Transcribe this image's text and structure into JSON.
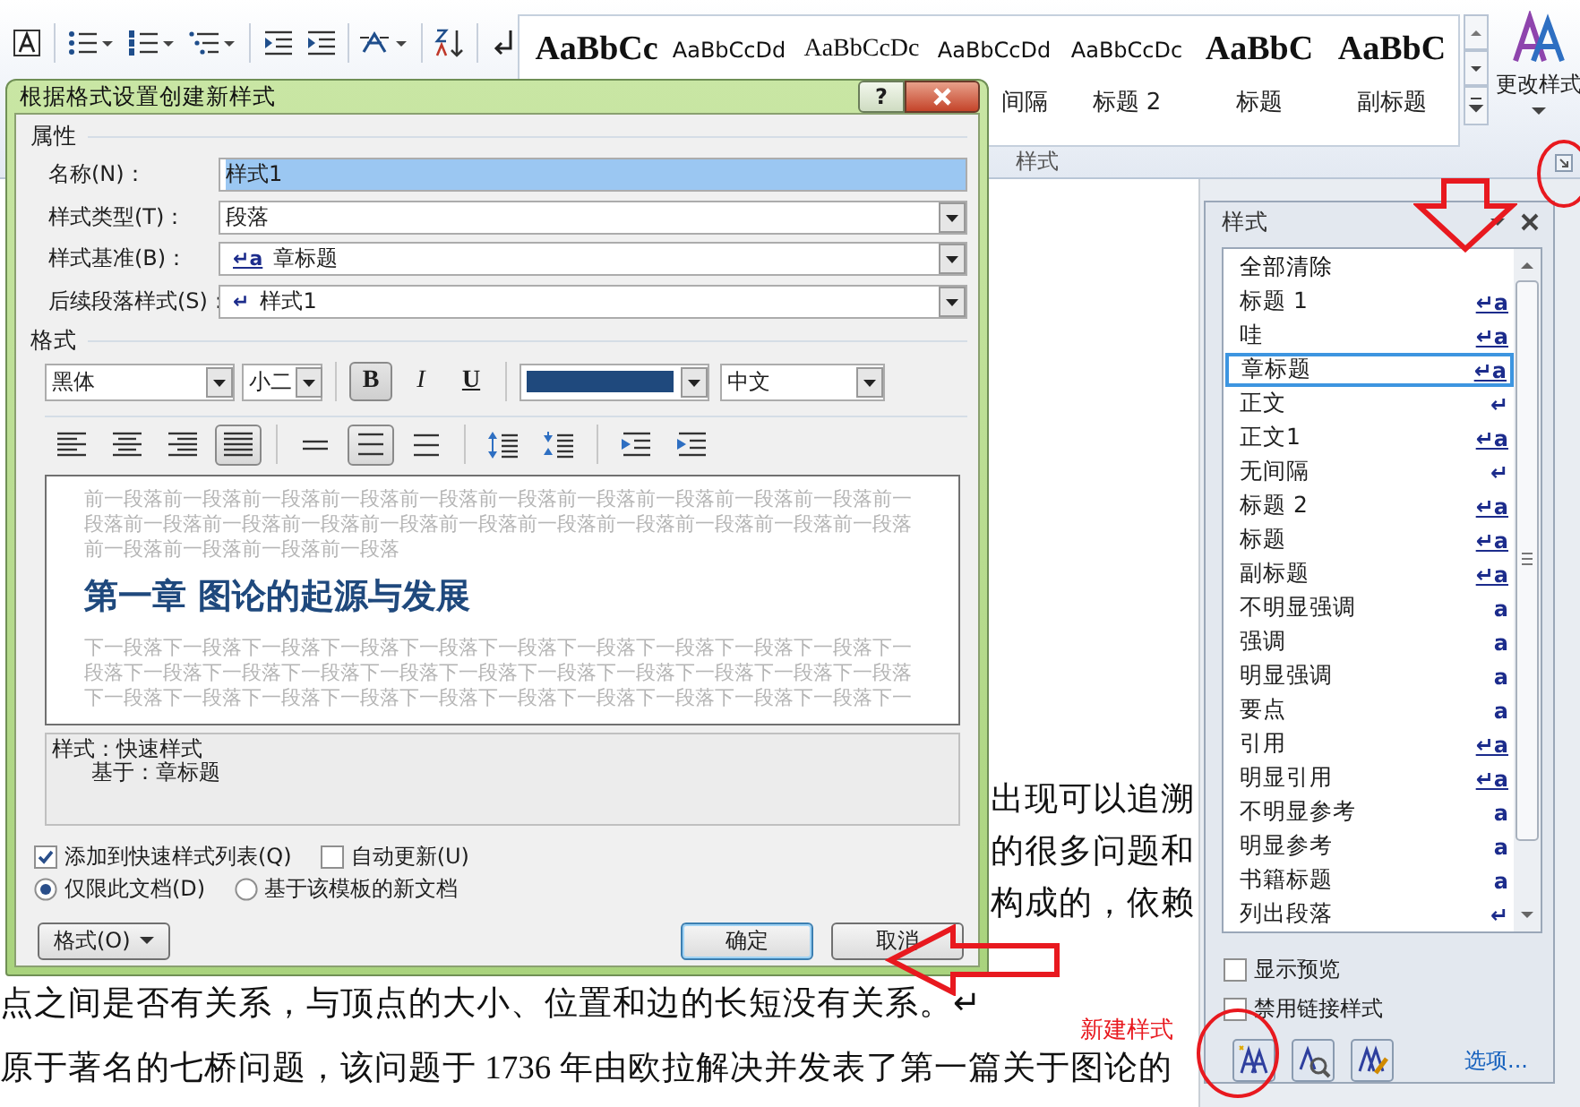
{
  "ribbon": {
    "gallery": [
      {
        "sample": "AaBbCc",
        "kind": "heading"
      },
      {
        "sample": "AaBbCcDd",
        "kind": "plain"
      },
      {
        "sample": "AaBbCcDc",
        "kind": "serif"
      },
      {
        "sample": "AaBbCcDd",
        "kind": "plain",
        "label": "间隔"
      },
      {
        "sample": "AaBbCcDc",
        "kind": "plain",
        "label": "标题 2"
      },
      {
        "sample": "AaBbC",
        "kind": "heading",
        "label": "标题"
      },
      {
        "sample": "AaBbC",
        "kind": "heading",
        "label": "副标题"
      }
    ],
    "change_styles": "更改样式",
    "group_label": "样式"
  },
  "document": {
    "lines": [
      {
        "text": "出现可以追溯",
        "kind": "tail"
      },
      {
        "text": "的很多问题和",
        "kind": "tail"
      },
      {
        "text": "构成的，依赖",
        "kind": "tail"
      },
      {
        "text": "点之间是否有关系，与顶点的大小、位置和边的长短没有关系。↵",
        "kind": "full"
      },
      {
        "text": "原于著名的七桥问题，该问题于 1736 年由欧拉解决并发表了第一篇关于图论的",
        "kind": "full"
      }
    ]
  },
  "dialog": {
    "title": "根据格式设置创建新样式",
    "help": "?",
    "properties": {
      "heading": "属性",
      "fields": [
        {
          "label": "名称(N)：",
          "value": "样式1",
          "kind": "text",
          "highlighted": true
        },
        {
          "label": "样式类型(T)：",
          "value": "段落",
          "kind": "select"
        },
        {
          "label": "样式基准(B)：",
          "marker": "↵a",
          "value": "章标题",
          "kind": "select"
        },
        {
          "label": "后续段落样式(S)：",
          "marker": "↵",
          "value": "样式1",
          "kind": "select"
        }
      ]
    },
    "format": {
      "heading": "格式",
      "font": "黑体",
      "size": "小二",
      "text_style_buttons": [
        {
          "label": "B",
          "pressed": true
        },
        {
          "label": "I",
          "pressed": false
        },
        {
          "label": "U",
          "pressed": false
        }
      ],
      "color": "#1f497d",
      "language": "中文",
      "paragraph_buttons": [
        {
          "selected": false
        },
        {
          "selected": false
        },
        {
          "selected": false
        },
        {
          "selected": true
        },
        {
          "selected": false
        },
        {
          "selected": true
        },
        {
          "selected": false
        },
        {
          "selected": false
        },
        {
          "selected": false
        },
        {
          "selected": false
        },
        {
          "selected": false
        }
      ]
    },
    "preview": {
      "before": "前一段落前一段落前一段落前一段落前一段落前一段落前一段落前一段落前一段落前一段落前一段落前一段落前一段落前一段落前一段落前一段落前一段落前一段落前一段落前一段落前一段落前一段落前一段落前一段落前一段落",
      "heading": "第一章  图论的起源与发展",
      "after": "下一段落下一段落下一段落下一段落下一段落下一段落下一段落下一段落下一段落下一段落下一段落下一段落下一段落下一段落下一段落下一段落下一段落下一段落下一段落下一段落下一段落下一段落下一段落下一段落下一段落下一段落下一段落下一段落下一段落下一段落下一段落下一"
    },
    "description": [
      "样式：快速样式",
      "基于：章标题"
    ],
    "options": [
      {
        "label": "添加到快速样式列表(Q)",
        "checked": true
      },
      {
        "label": "自动更新(U)",
        "checked": false
      }
    ],
    "scope": [
      {
        "label": "仅限此文档(D)",
        "selected": true
      },
      {
        "label": "基于该模板的新文档",
        "selected": false
      }
    ],
    "format_button": "格式(O)",
    "ok": "确定",
    "cancel": "取消"
  },
  "styles_pane": {
    "title": "样式",
    "items": [
      {
        "name": "全部清除",
        "kind": "clear",
        "selected": false
      },
      {
        "name": "标题 1",
        "kind": "linked",
        "marker": "↵a",
        "selected": false
      },
      {
        "name": "哇",
        "kind": "linked",
        "marker": "↵a",
        "selected": false
      },
      {
        "name": "章标题",
        "kind": "linked",
        "marker": "↵a",
        "selected": true
      },
      {
        "name": "正文",
        "kind": "paragraph",
        "marker": "↵",
        "selected": false
      },
      {
        "name": "正文1",
        "kind": "linked",
        "marker": "↵a",
        "selected": false
      },
      {
        "name": "无间隔",
        "kind": "paragraph",
        "marker": "↵",
        "selected": false
      },
      {
        "name": "标题 2",
        "kind": "linked",
        "marker": "↵a",
        "selected": false
      },
      {
        "name": "标题",
        "kind": "linked",
        "marker": "↵a",
        "selected": false
      },
      {
        "name": "副标题",
        "kind": "linked",
        "marker": "↵a",
        "selected": false
      },
      {
        "name": "不明显强调",
        "kind": "character",
        "marker": "a",
        "selected": false
      },
      {
        "name": "强调",
        "kind": "character",
        "marker": "a",
        "selected": false
      },
      {
        "name": "明显强调",
        "kind": "character",
        "marker": "a",
        "selected": false
      },
      {
        "name": "要点",
        "kind": "character",
        "marker": "a",
        "selected": false
      },
      {
        "name": "引用",
        "kind": "linked",
        "marker": "↵a",
        "selected": false
      },
      {
        "name": "明显引用",
        "kind": "linked",
        "marker": "↵a",
        "selected": false
      },
      {
        "name": "不明显参考",
        "kind": "character",
        "marker": "a",
        "selected": false
      },
      {
        "name": "明显参考",
        "kind": "character",
        "marker": "a",
        "selected": false
      },
      {
        "name": "书籍标题",
        "kind": "character",
        "marker": "a",
        "selected": false
      },
      {
        "name": "列出段落",
        "kind": "paragraph",
        "marker": "↵",
        "selected": false
      }
    ],
    "options": [
      {
        "label": "显示预览",
        "checked": false
      },
      {
        "label": "禁用链接样式",
        "checked": false
      }
    ],
    "options_link": "选项..."
  },
  "annotation": {
    "label": "新建样式"
  }
}
